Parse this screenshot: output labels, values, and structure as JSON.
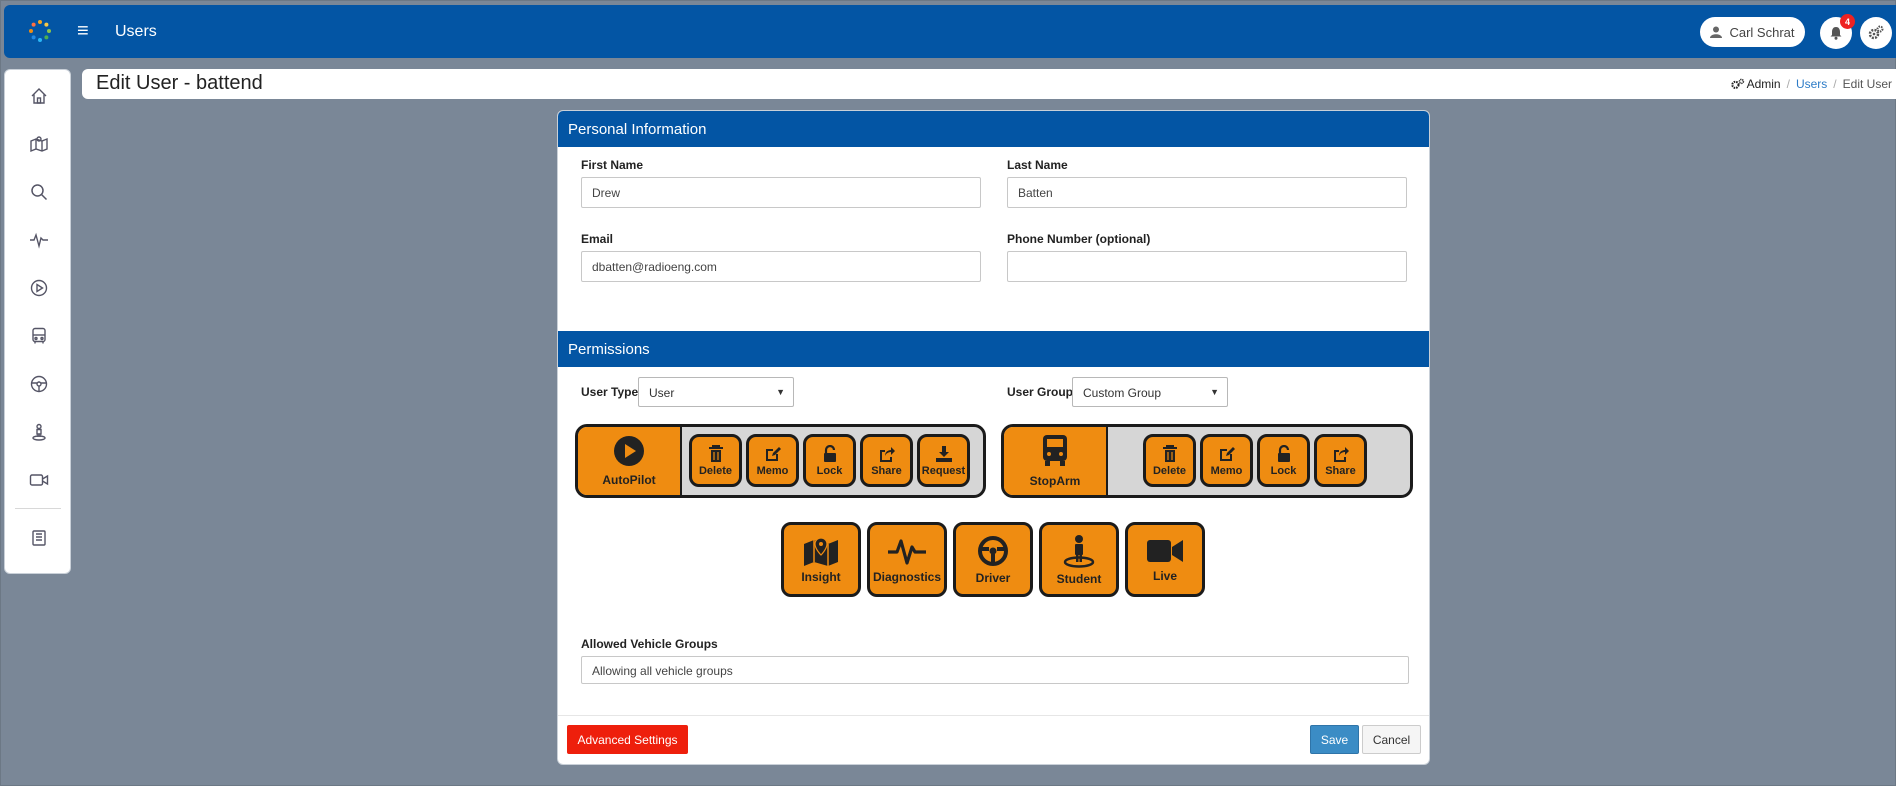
{
  "app": {
    "title": "Users",
    "user_name": "Carl Schrat",
    "notification_count": "4"
  },
  "colors": {
    "brand": "#0355a4",
    "module": "#ef8c11",
    "danger": "#ee1f0c",
    "primary": "#3b8cc5"
  },
  "sidebar": {
    "items": [
      {
        "icon": "home-icon"
      },
      {
        "icon": "map-icon"
      },
      {
        "icon": "search-icon"
      },
      {
        "icon": "pulse-icon"
      },
      {
        "icon": "play-icon"
      },
      {
        "icon": "bus-icon"
      },
      {
        "icon": "steering-wheel-icon"
      },
      {
        "icon": "student-icon"
      },
      {
        "icon": "video-icon"
      },
      {
        "icon": "book-icon"
      }
    ]
  },
  "page": {
    "title": "Edit User - battend",
    "breadcrumb": {
      "admin": "Admin",
      "users": "Users",
      "current": "Edit User"
    }
  },
  "personal": {
    "heading": "Personal Information",
    "first_name_label": "First Name",
    "first_name": "Drew",
    "last_name_label": "Last Name",
    "last_name": "Batten",
    "email_label": "Email",
    "email": "dbatten@radioeng.com",
    "phone_label": "Phone Number (optional)",
    "phone": ""
  },
  "permissions": {
    "heading": "Permissions",
    "user_type_label": "User Type",
    "user_type": "User",
    "user_group_label": "User Group",
    "user_group": "Custom Group",
    "autopilot": {
      "label": "AutoPilot",
      "subs": [
        "Delete",
        "Memo",
        "Lock",
        "Share",
        "Request"
      ]
    },
    "stoparm": {
      "label": "StopArm",
      "subs": [
        "Delete",
        "Memo",
        "Lock",
        "Share"
      ]
    },
    "modules": [
      "Insight",
      "Diagnostics",
      "Driver",
      "Student",
      "Live"
    ],
    "vehicle_groups_label": "Allowed Vehicle Groups",
    "vehicle_groups": "Allowing all vehicle groups"
  },
  "footer": {
    "advanced": "Advanced Settings",
    "save": "Save",
    "cancel": "Cancel"
  }
}
